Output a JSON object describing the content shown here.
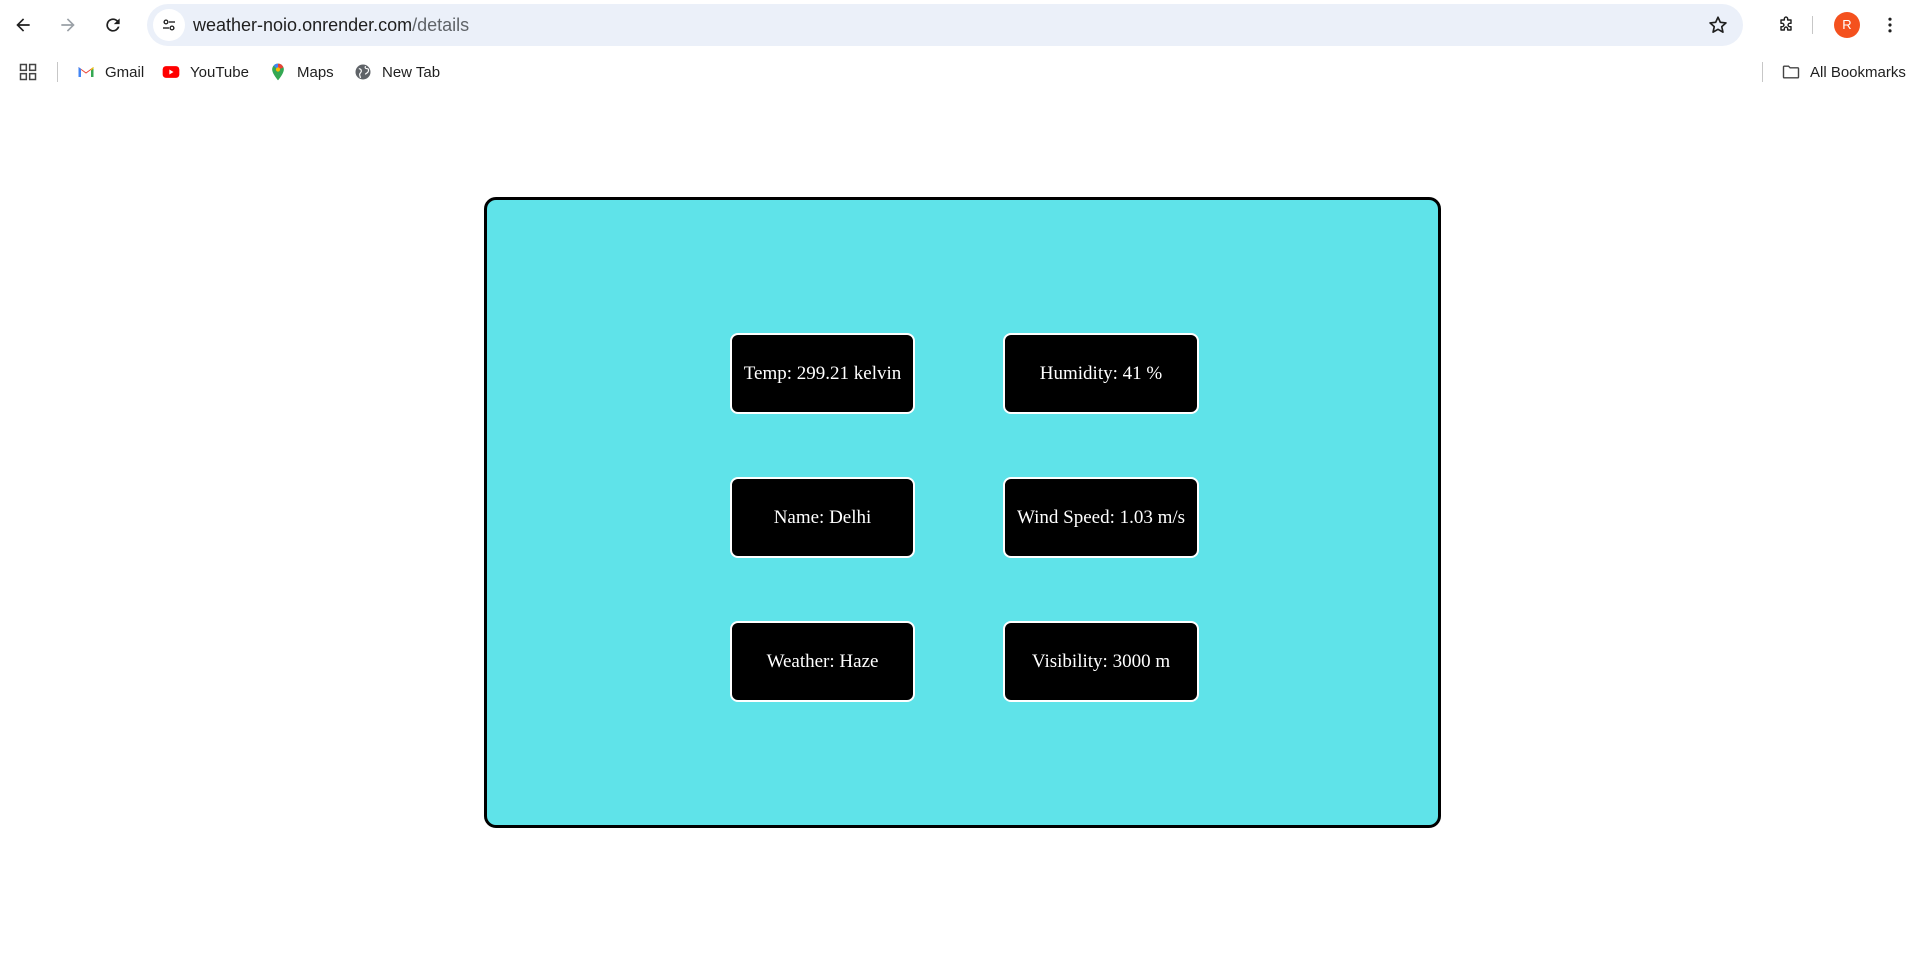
{
  "browser": {
    "url_host": "weather-noio.onrender.com",
    "url_path": "/details",
    "profile_initial": "R"
  },
  "bookmarks": {
    "items": [
      {
        "label": "Gmail",
        "icon": "gmail-icon"
      },
      {
        "label": "YouTube",
        "icon": "youtube-icon"
      },
      {
        "label": "Maps",
        "icon": "maps-icon"
      },
      {
        "label": "New Tab",
        "icon": "globe-icon"
      }
    ],
    "all_bookmarks": "All Bookmarks"
  },
  "weather": {
    "temp": "Temp: 299.21 kelvin",
    "humidity": "Humidity: 41 %",
    "name": "Name: Delhi",
    "wind_speed": "Wind Speed: 1.03 m/s",
    "weather": "Weather: Haze",
    "visibility": "Visibility: 3000 m"
  },
  "colors": {
    "panel_background": "#5fe3e9",
    "card_background": "#000000",
    "card_text": "#ffffff",
    "avatar": "#f4511e"
  }
}
